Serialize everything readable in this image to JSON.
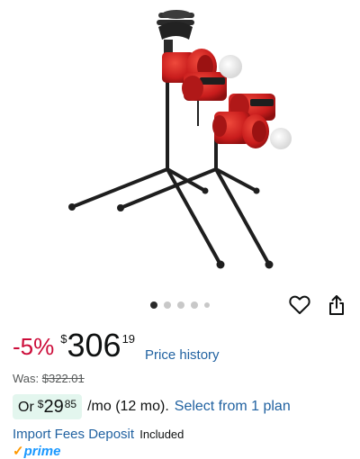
{
  "product": {
    "image_alt": "Pitching machine on tripod stands",
    "gallery": {
      "dot_count": 5,
      "active_index": 0
    }
  },
  "actions": {
    "wishlist_icon": "heart-outline-icon",
    "share_icon": "share-icon"
  },
  "price": {
    "discount": "-5%",
    "currency_symbol": "$",
    "whole": "306",
    "fraction": "19",
    "history_link": "Price history",
    "was_label": "Was: ",
    "was_value": "$322.01"
  },
  "monthly": {
    "or_label": "Or",
    "currency_symbol": "$",
    "whole": "29",
    "fraction": "85",
    "term": "/mo (12 mo).",
    "select_plan_link": "Select from 1 plan"
  },
  "import_fees": {
    "link": "Import Fees Deposit",
    "status": "Included"
  },
  "prime": {
    "check": "✓",
    "label": "prime"
  },
  "colors": {
    "discount": "#cc0c39",
    "link": "#2162a1",
    "monthly_badge_bg": "#e3f6ee",
    "prime_blue": "#1a98ff",
    "prime_orange": "#ff9900",
    "machine_red": "#d42020"
  }
}
